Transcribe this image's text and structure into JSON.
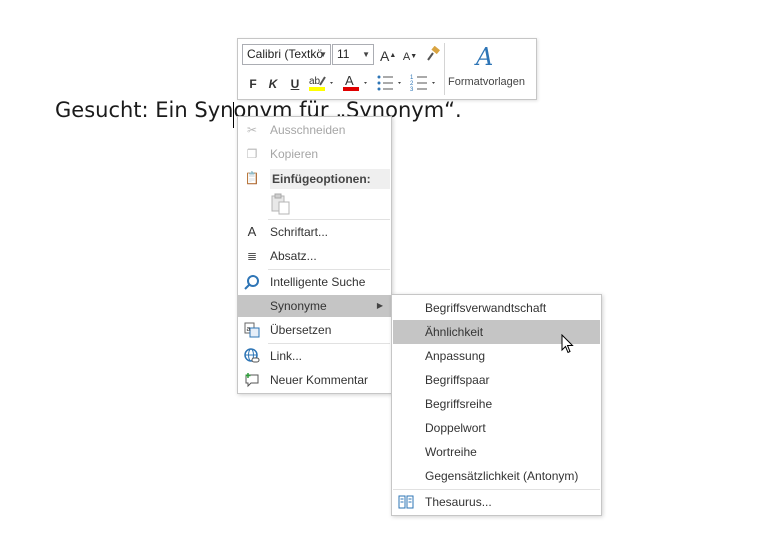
{
  "document": {
    "text": "Gesucht: Ein Synonym für „Synonym“."
  },
  "mini_toolbar": {
    "font_name": "Calibri (Textkö",
    "font_size": "11",
    "grow_font": "A",
    "shrink_font": "A",
    "bold": "F",
    "italic": "K",
    "underline": "U",
    "font_color": "A",
    "styles_label": "Formatvorlagen"
  },
  "context_menu": {
    "items": [
      {
        "label": "Ausschneiden",
        "icon": "scissors-icon",
        "disabled": true
      },
      {
        "label": "Kopieren",
        "icon": "copy-icon",
        "disabled": true
      },
      {
        "label": "Einfügeoptionen:",
        "icon": "paste-icon",
        "header": true
      },
      {
        "label": "Schriftart...",
        "icon": "font-icon"
      },
      {
        "label": "Absatz...",
        "icon": "paragraph-icon"
      },
      {
        "label": "Intelligente Suche",
        "icon": "smart-lookup-icon"
      },
      {
        "label": "Synonyme",
        "icon": "",
        "highlighted": true,
        "submenu": true
      },
      {
        "label": "Übersetzen",
        "icon": "translate-icon"
      },
      {
        "label": "Link...",
        "icon": "link-icon"
      },
      {
        "label": "Neuer Kommentar",
        "icon": "comment-icon"
      }
    ]
  },
  "synonyms_submenu": {
    "items": [
      {
        "label": "Begriffsverwandtschaft"
      },
      {
        "label": "Ähnlichkeit",
        "highlighted": true
      },
      {
        "label": "Anpassung"
      },
      {
        "label": "Begriffspaar"
      },
      {
        "label": "Begriffsreihe"
      },
      {
        "label": "Doppelwort"
      },
      {
        "label": "Wortreihe"
      },
      {
        "label": "Gegensätzlichkeit (Antonym)"
      }
    ],
    "thesaurus": "Thesaurus..."
  },
  "colors": {
    "highlight": "#c5c5c5",
    "accent_blue": "#2e75b6",
    "font_color_red": "#e00000",
    "highlighter_yellow": "#ffff00"
  }
}
